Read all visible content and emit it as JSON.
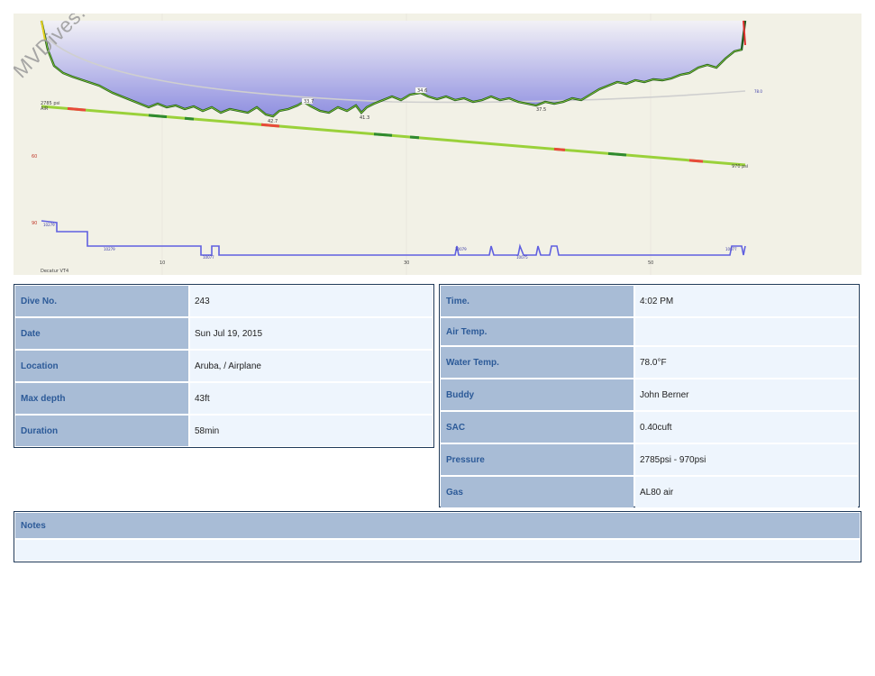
{
  "watermark": "MVDives.com",
  "profile": {
    "start_pressure_label": "2785 psi",
    "gas_label": "AIR",
    "end_pressure_label": "970 psi",
    "temp_label": "78.0",
    "max_depth_marker": "42.7",
    "depth_markers": [
      "33.7",
      "41.3",
      "34.6",
      "37.5"
    ],
    "left_axis_labels": [
      "60",
      "90"
    ],
    "time_axis_labels": [
      "10",
      "30",
      "50"
    ],
    "footer_label": "Decatur VT4",
    "ceiling_labels": [
      "10279",
      "10279",
      "10077",
      "10077",
      "10079",
      "10075",
      "10077"
    ],
    "colors": {
      "water": "#9898e0",
      "depth_line": "#1f5a1f",
      "pressure_line": "#9ad13a",
      "ceiling": "#6060e0"
    }
  },
  "left_table": [
    {
      "label": "Dive No.",
      "value": "243"
    },
    {
      "label": "Date",
      "value": "Sun Jul 19, 2015"
    },
    {
      "label": "Location",
      "value": "Aruba, / Airplane"
    },
    {
      "label": "Max depth",
      "value": "43ft"
    },
    {
      "label": "Duration",
      "value": "58min"
    }
  ],
  "right_table": [
    {
      "label": "Time.",
      "value": "4:02 PM"
    },
    {
      "label": "Air Temp.",
      "value": ""
    },
    {
      "label": "Water Temp.",
      "value": "78.0°F"
    },
    {
      "label": "Buddy",
      "value": "John Berner"
    },
    {
      "label": "SAC",
      "value": "0.40cuft"
    },
    {
      "label": "Pressure",
      "value": "2785psi - 970psi"
    },
    {
      "label": "Gas",
      "value": "AL80 air"
    }
  ],
  "notes": {
    "label": "Notes",
    "text": ""
  }
}
